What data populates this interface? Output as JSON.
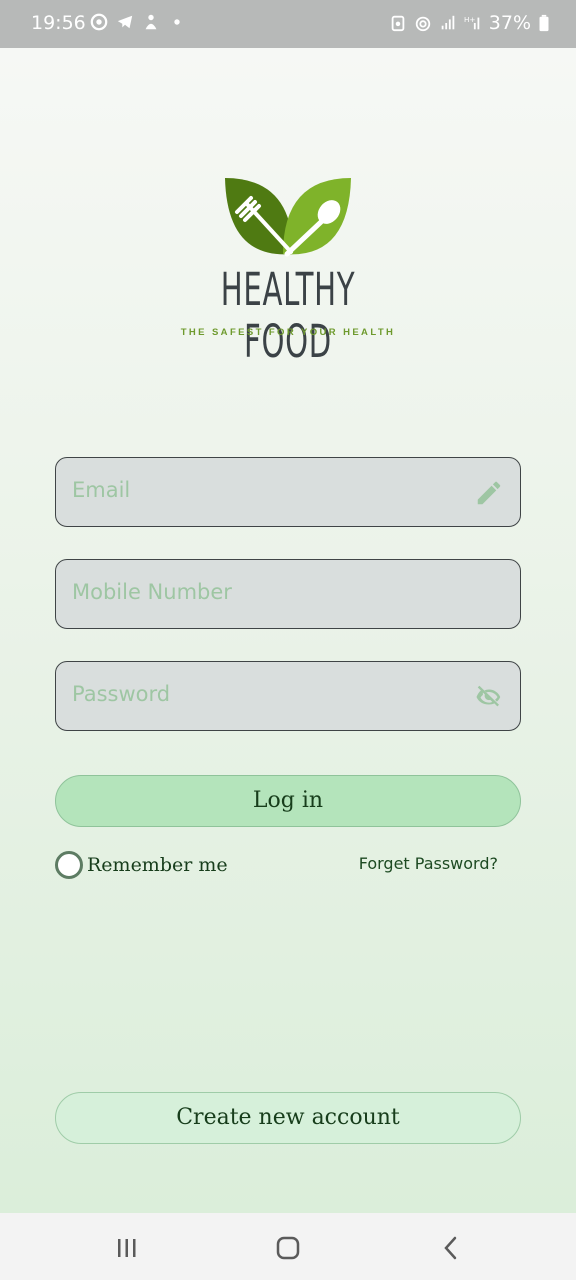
{
  "status_bar": {
    "time": "19:56",
    "left_icons": [
      "chrome-icon",
      "telegram-icon",
      "app-notification-icon",
      "dot-icon"
    ],
    "battery": "37%",
    "right_icons": [
      "alarm-icon",
      "hotspot-icon",
      "signal-icon",
      "h-plus-signal-icon",
      "battery-icon"
    ]
  },
  "logo": {
    "title": "HEALTHY FOOD",
    "tagline": "THE SAFEST FOR YOUR HEALTH"
  },
  "form": {
    "email_placeholder": "Email",
    "mobile_placeholder": "Mobile Number",
    "password_placeholder": "Password"
  },
  "actions": {
    "login_label": "Log in",
    "remember_label": "Remember me",
    "forgot_label": "Forget Password?",
    "create_label": "Create new account"
  },
  "nav": {
    "icons": [
      "recent-apps-icon",
      "home-icon",
      "back-icon"
    ]
  },
  "colors": {
    "accent_green": "#b4e4bb",
    "logo_leaf_dark": "#4f7a12",
    "logo_leaf_light": "#7fb32a",
    "placeholder": "#9ec6a3"
  }
}
